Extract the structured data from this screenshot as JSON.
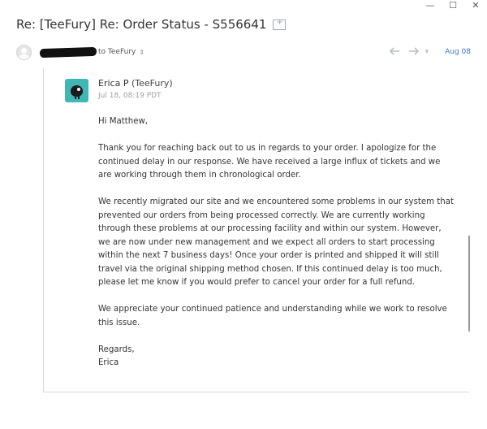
{
  "window": {
    "minimize": "—",
    "maximize": "☐",
    "close": "✕"
  },
  "message": {
    "subject": "Re: [TeeFury] Re: Order Status - S556641",
    "recipient_text": "to TeeFury",
    "date": "Aug 08",
    "icons": {
      "folder": "folder-add-icon",
      "reply": "reply-icon",
      "forward": "forward-icon",
      "more": "chevron-down-icon"
    }
  },
  "reply": {
    "sender_name": "Erica P",
    "sender_org": "(TeeFury)",
    "timestamp": "Jul 18, 08:19 PDT",
    "brand_color": "#3fb7b5",
    "greeting": "Hi Matthew,",
    "paragraphs": [
      "Thank you for reaching back out to us in regards to your order. I apologize for the continued delay in our response. We have received a large influx of tickets and we are working through them in chronological order.",
      "We recently migrated our site and we encountered some problems in our system that prevented our orders from being processed correctly. We are currently working through these problems at our processing facility and within our system. However, we are now under new management and we expect all orders to start processing within the next 7 business days!  Once your order is printed and shipped it will still travel via the original shipping method chosen. If this continued delay is too much, please let me know if you would prefer to cancel your order for a full refund.",
      "We appreciate your continued patience and understanding while we work to resolve this issue."
    ],
    "signoff": "Regards,",
    "signature": "Erica"
  }
}
